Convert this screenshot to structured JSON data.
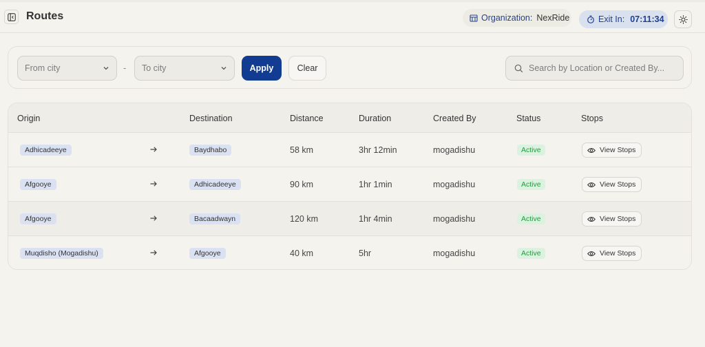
{
  "header": {
    "title": "Routes",
    "org_label": "Organization:",
    "org_name": "NexRide",
    "exit_label": "Exit In:",
    "exit_time": "07:11:34"
  },
  "filters": {
    "from_placeholder": "From city",
    "separator": "-",
    "to_placeholder": "To city",
    "apply_label": "Apply",
    "clear_label": "Clear",
    "search_placeholder": "Search by Location or Created By..."
  },
  "table": {
    "headers": [
      "Origin",
      "Destination",
      "Distance",
      "Duration",
      "Created By",
      "Status",
      "Stops"
    ],
    "view_stops_label": "View Stops",
    "rows": [
      {
        "origin": "Adhicadeeye",
        "destination": "Baydhabo",
        "distance": "58 km",
        "duration": "3hr 12min",
        "created_by": "mogadishu",
        "status": "Active"
      },
      {
        "origin": "Afgooye",
        "destination": "Adhicadeeye",
        "distance": "90 km",
        "duration": "1hr 1min",
        "created_by": "mogadishu",
        "status": "Active"
      },
      {
        "origin": "Afgooye",
        "destination": "Bacaadwayn",
        "distance": "120 km",
        "duration": "1hr 4min",
        "created_by": "mogadishu",
        "status": "Active"
      },
      {
        "origin": "Muqdisho (Mogadishu)",
        "destination": "Afgooye",
        "distance": "40 km",
        "duration": "5hr",
        "created_by": "mogadishu",
        "status": "Active"
      }
    ]
  },
  "icons": {
    "sidebar_toggle": "sidebar-toggle-icon",
    "organization": "building-icon",
    "exit_timer": "stopwatch-icon",
    "theme": "sun-icon",
    "dropdown": "chevron-down-icon",
    "search": "search-icon",
    "route_arrow": "arrow-right-icon",
    "view": "eye-icon"
  },
  "colors": {
    "background": "#f5f3ee",
    "primary": "#123c91",
    "chip": "#d9e1f2",
    "status_active_bg": "#dcf2e0",
    "status_active_text": "#1f9d3a"
  }
}
